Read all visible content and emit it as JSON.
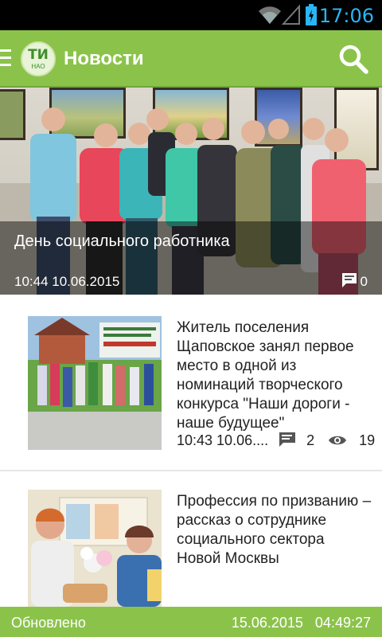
{
  "status_bar": {
    "time": "17:06"
  },
  "app_bar": {
    "logo_top": "ТИ",
    "logo_bottom": "НАО",
    "title": "Новости"
  },
  "featured": {
    "headline": "День социального работника",
    "timestamp": "10:44 10.06.2015",
    "comments": "0"
  },
  "articles": [
    {
      "title": "Житель поселения Щаповское занял первое место в одной из номинаций творческого конкурса \"Наши дороги - наше будущее\"",
      "timestamp": "10:43 10.06....",
      "comments": "2",
      "views": "19"
    },
    {
      "title": "Профессия по призванию – рассказ о сотруднике социального сектора Новой Москвы"
    }
  ],
  "footer": {
    "left": "Обновлено",
    "right": "15.06.2015   04:49:27"
  },
  "colors": {
    "accent_green": "#8bc34a",
    "status_blue": "#29b6f6"
  }
}
